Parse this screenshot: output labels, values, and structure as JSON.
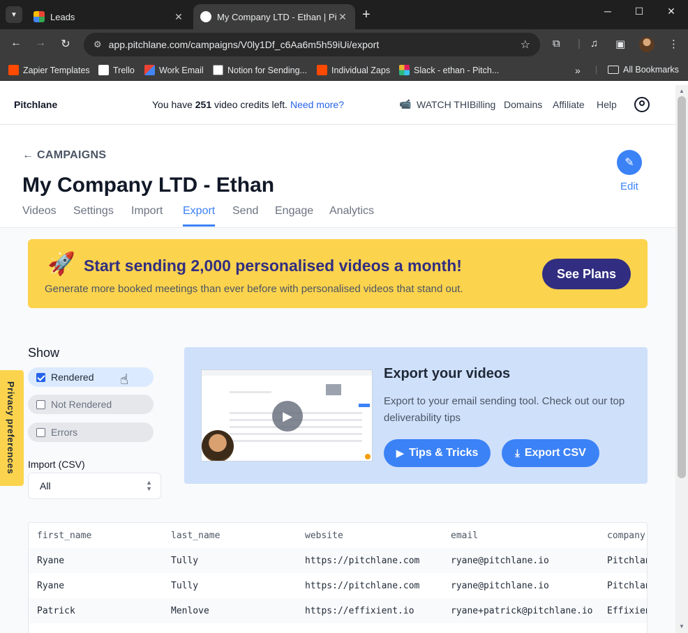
{
  "browser": {
    "tabs": [
      {
        "title": "Leads",
        "active": false
      },
      {
        "title": "My Company LTD - Ethan | Pitc",
        "active": true
      }
    ],
    "url": "app.pitchlane.com/campaigns/V0ly1Df_c6Aa6m5h59iUi/export",
    "bookmarks": [
      {
        "label": "Zapier Templates",
        "color": "#ff4a00"
      },
      {
        "label": "Trello",
        "color": "#ffffff"
      },
      {
        "label": "Work Email",
        "color": "#ea4335"
      },
      {
        "label": "Notion for Sending...",
        "color": "#ffffff"
      },
      {
        "label": "Individual Zaps",
        "color": "#ff4a00"
      },
      {
        "label": "Slack - ethan - Pitch...",
        "color": "#e01e5a"
      }
    ],
    "all_bookmarks": "All Bookmarks"
  },
  "topnav": {
    "brand": "Pitchlane",
    "credits_prefix": "You have ",
    "credits_count": "251",
    "credits_suffix": " video credits left. ",
    "need_more": "Need more?",
    "watch": "WATCH THIBilling",
    "domains": "Domains",
    "affiliate": "Affiliate",
    "help": "Help"
  },
  "campaign": {
    "back": "← CAMPAIGNS",
    "title": "My Company LTD - Ethan",
    "edit": "Edit",
    "tabs": [
      "Videos",
      "Settings",
      "Import",
      "Export",
      "Send",
      "Engage",
      "Analytics"
    ],
    "active_tab": "Export"
  },
  "promo": {
    "headline": "Start sending 2,000 personalised videos a month!",
    "sub": "Generate more booked meetings than ever before with personalised videos that stand out.",
    "button": "See Plans"
  },
  "filters": {
    "show": "Show",
    "options": [
      {
        "label": "Rendered",
        "checked": true
      },
      {
        "label": "Not Rendered",
        "checked": false
      },
      {
        "label": "Errors",
        "checked": false
      }
    ],
    "import_label": "Import (CSV)",
    "import_value": "All"
  },
  "export": {
    "title": "Export your videos",
    "desc": "Export to your email sending tool. Check out our top deliverability tips",
    "tips_button": "Tips & Tricks",
    "csv_button": "Export CSV"
  },
  "privacy": "Privacy preferences",
  "table": {
    "columns": [
      "first_name",
      "last_name",
      "website",
      "email",
      "company"
    ],
    "rows": [
      [
        "Ryane",
        "Tully",
        "https://pitchlane.com",
        "ryane@pitchlane.io",
        "Pitchlan"
      ],
      [
        "Ryane",
        "Tully",
        "https://pitchlane.com",
        "ryane@pitchlane.io",
        "Pitchlan"
      ],
      [
        "Patrick",
        "Menlove",
        "https://effixient.io",
        "ryane+patrick@pitchlane.io",
        "Effixien"
      ]
    ]
  },
  "colors": {
    "accent": "#3b82f6",
    "promo_bg": "#fcd34d",
    "promo_text": "#312e81",
    "export_card": "#cfe0fb"
  }
}
